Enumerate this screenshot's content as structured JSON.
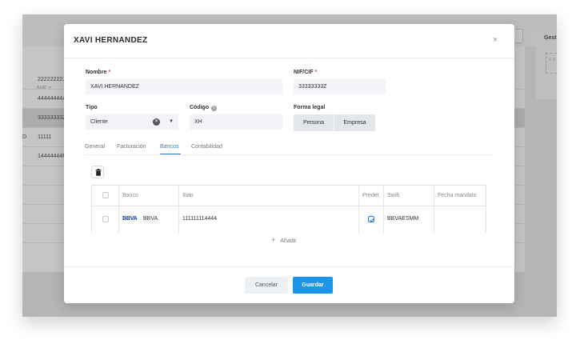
{
  "background": {
    "nif_header": "NIF",
    "rows": [
      {
        "lead": "",
        "nif": "22222222J"
      },
      {
        "lead": "",
        "nif": "44444444A"
      },
      {
        "lead": "",
        "nif": "33333333Z"
      },
      {
        "lead": "D",
        "nif": "11111"
      },
      {
        "lead": "",
        "nif": "14444444F"
      }
    ],
    "side_panel_title": "Gest",
    "side_panel_text": "e\ne\n"
  },
  "modal": {
    "title": "XAVI HERNANDEZ",
    "close": "×"
  },
  "form": {
    "nombre": {
      "label": "Nombre",
      "required": "*",
      "value": "XAVI HERNANDEZ"
    },
    "nif": {
      "label": "NIF/CIF",
      "required": "*",
      "value": "33333333Z"
    },
    "tipo": {
      "label": "Tipo",
      "value": "Cliente"
    },
    "codigo": {
      "label": "Código",
      "value": "XH"
    },
    "forma_legal": {
      "label": "Forma legal",
      "options": [
        "Persona",
        "Empresa"
      ]
    }
  },
  "tabs": [
    "General",
    "Facturación",
    "Bancos",
    "Contabilidad"
  ],
  "active_tab": "Bancos",
  "bank_table": {
    "columns": [
      "",
      "Banco",
      "Iban",
      "Predet.",
      "Swift",
      "Fecha mandato"
    ],
    "rows": [
      {
        "logo": "BBVA",
        "bank": "BBVA",
        "iban": "111111114444",
        "default": true,
        "swift": "BBVAESMM",
        "fecha_mandato": ""
      }
    ]
  },
  "add_label": "Añadir",
  "footer": {
    "cancel": "Cancelar",
    "save": "Guardar"
  },
  "colors": {
    "accent": "#1a95e8",
    "active_tab": "#2a7fd4",
    "required": "#e5484d"
  },
  "icons": {
    "close": "close-icon",
    "clear": "clear-icon",
    "dropdown": "chevron-down-icon",
    "info": "info-icon",
    "delete": "trash-icon",
    "add": "plus-icon",
    "checked": "check-icon",
    "filter": "filter-icon"
  }
}
